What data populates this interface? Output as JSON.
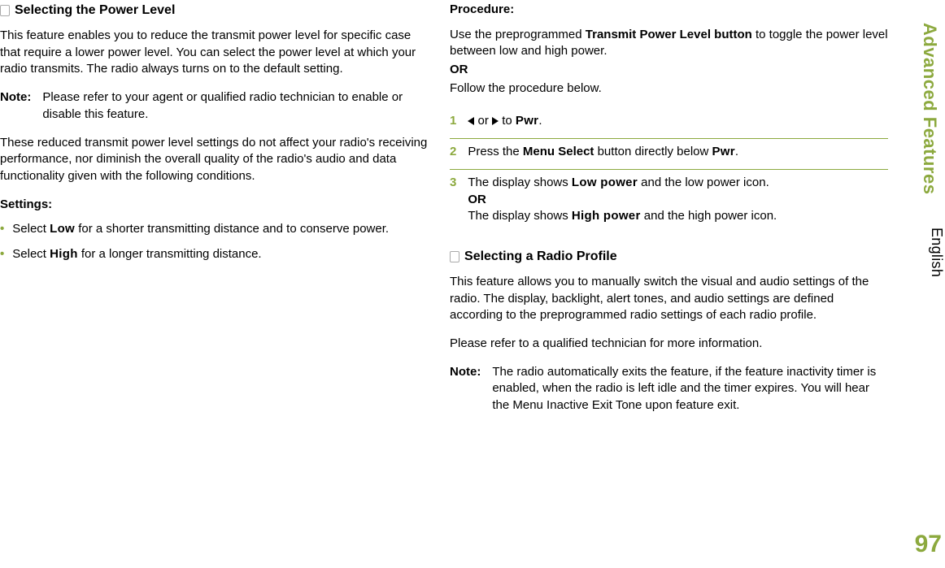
{
  "side": {
    "tab": "Advanced Features",
    "lang": "English",
    "page": "97"
  },
  "left": {
    "section_title": "Selecting the Power Level",
    "intro": "This feature enables you to reduce the transmit power level for specific case that require a lower power level. You can select the power level at which your radio transmits. The radio always turns on to the default setting.",
    "note_label": "Note:",
    "note_text": "Please refer to your agent or qualified radio technician to enable or disable this feature.",
    "para2": "These reduced transmit power level settings do not affect your radio's receiving performance, nor diminish the overall quality of the radio's audio and data functionality given with the following conditions.",
    "settings_label": "Settings:",
    "bullets": [
      {
        "pre": "Select ",
        "strong": "Low",
        "post": " for a shorter transmitting distance and to conserve power."
      },
      {
        "pre": "Select ",
        "strong": "High",
        "post": " for a longer transmitting distance."
      }
    ]
  },
  "right": {
    "procedure_label": "Procedure:",
    "proc_pre": "Use the preprogrammed ",
    "proc_bold": "Transmit Power Level button",
    "proc_post": " to toggle the power level between low and high power.",
    "or": "OR",
    "follow": "Follow the procedure below.",
    "steps": {
      "s1": {
        "or": " or ",
        "to": " to ",
        "pwr": "Pwr",
        "end": "."
      },
      "s2": {
        "pre": "Press the ",
        "bold": "Menu Select",
        "mid": " button directly below ",
        "pwr": "Pwr",
        "end": "."
      },
      "s3": {
        "line1_pre": "The display shows ",
        "line1_strong": "Low power",
        "line1_post": " and the low power icon.",
        "or": "OR",
        "line2_pre": "The display shows ",
        "line2_strong": "High power",
        "line2_post": " and the high power icon."
      }
    },
    "section2_title": "Selecting a Radio Profile",
    "section2_p1": "This feature allows you to manually switch the visual and audio settings of the radio. The display, backlight, alert tones, and audio settings are defined according to the preprogrammed radio settings of each radio profile.",
    "section2_p2": "Please refer to a qualified technician for more information.",
    "note2_label": "Note:",
    "note2_text": "The radio automatically exits the feature, if the feature inactivity timer is enabled, when the radio is left idle and the timer expires. You will hear the Menu Inactive Exit Tone upon feature exit."
  }
}
